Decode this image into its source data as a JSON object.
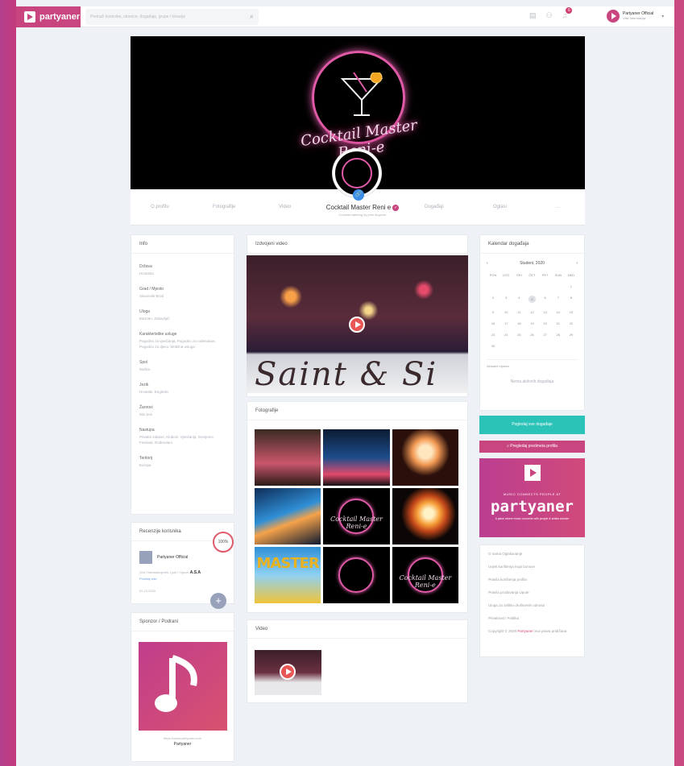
{
  "topbar": {
    "brand": "partyaner",
    "search_placeholder": "Pretraži korisnike, stranice, događaje, grupe i lokacije",
    "notification_count": "6",
    "user_name": "Partyaner Official",
    "user_sub": "Više informacija"
  },
  "cover": {
    "neon_title": "Cocktail Master Reni-e"
  },
  "profile": {
    "name": "Cocktail Master Reni e",
    "subtitle": "Cocktail catering by jobs dogovor",
    "tabs": [
      "O profilu",
      "Fotografije",
      "Video",
      "Događaji",
      "Oglasi",
      "..."
    ]
  },
  "info": {
    "title": "Info",
    "items": [
      {
        "k": "Država",
        "v": "Hrvatska"
      },
      {
        "k": "Grad / Mjesto",
        "v": "Slavonski Brod"
      },
      {
        "k": "Uloga",
        "v": "Barmen, Zabavljač"
      },
      {
        "k": "Karakteristike usluge",
        "v": "Pogodno za vjenčanja, Pogodno za rođendane, Pogodno za djecu, Mobilna usluga"
      },
      {
        "k": "Spol",
        "v": "Muško"
      },
      {
        "k": "Jezik",
        "v": "Hrvatski, Engleski"
      },
      {
        "k": "Žanrovi",
        "v": "Mix Sve"
      },
      {
        "k": "Nastupa",
        "v": "Privatni zabave, Klubovi, Vjenčanja, Domjenci, Festivali, Rođendani"
      },
      {
        "k": "Teritorij",
        "v": "Europa"
      }
    ]
  },
  "reviews": {
    "title": "Recenzije korisnika",
    "percent": "100%",
    "author": "Partyaner Official",
    "text_a": "Vrlo i Nenadomjestiv Ljudi i Cijena!",
    "text_b": "A.S.A",
    "text_c": "Pročitaj više",
    "date": "22.10.2020",
    "add": "+"
  },
  "sponsor": {
    "title": "Sponzor / Podrani",
    "url": "https://www.partyaner.com",
    "name": "Partyaner"
  },
  "featured_video": {
    "title": "Izdvojeni video",
    "banner": "Saint & Si"
  },
  "photos": {
    "title": "Fotografije",
    "master": "MASTER",
    "mini_title": "Cocktail Master Reni-e"
  },
  "videos": {
    "title": "Video"
  },
  "calendar": {
    "title": "Kalendar događaja",
    "month": "Studeni, 2020",
    "prev": "‹",
    "next": "›",
    "weekdays": [
      "PON",
      "UTO",
      "SRI",
      "ČET",
      "PET",
      "SUB",
      "NED"
    ],
    "rows": [
      [
        "",
        "",
        "",
        "",
        "",
        "",
        "1"
      ],
      [
        "2",
        "3",
        "4",
        "5",
        "6",
        "7",
        "8"
      ],
      [
        "9",
        "10",
        "11",
        "12",
        "13",
        "14",
        "15"
      ],
      [
        "16",
        "17",
        "18",
        "19",
        "20",
        "21",
        "22"
      ],
      [
        "23",
        "24",
        "25",
        "26",
        "27",
        "28",
        "29"
      ],
      [
        "30",
        "",
        "",
        "",
        "",
        "",
        ""
      ]
    ],
    "selected": "5",
    "current_month_link": "Aktualni mjesec",
    "empty": "Nema aktivnih događaja",
    "view_btn": "Pogledaj sve događaje",
    "report_btn": "Pregledaj predmeta profila"
  },
  "promo": {
    "line1": "MUSIC CONNECTS PEOPLE AT",
    "brand": "partyaner",
    "line3": "A place where music connects with people & artists wonder"
  },
  "footer_links": {
    "rows": [
      [
        "O nama",
        "Oglašavanje"
      ],
      [
        "Uvjeti korištenja",
        "Kupi bonove"
      ],
      [
        "Pravila korištenja profila"
      ],
      [
        "Pravila prodavanja",
        "Upute"
      ],
      [
        "Uloga za zaštitu društvenih odnosa"
      ],
      [
        "Privatnost i Politika"
      ]
    ],
    "copyright_a": "Copyright © 2020",
    "copyright_brand": "Partyaner",
    "copyright_b": "Sva prava pridržana"
  },
  "colors": {
    "brand": "#c8457f",
    "teal": "#2bc2b7",
    "blue": "#3b8ee8",
    "green": "#2ec04d",
    "purple": "#7a4bd1"
  }
}
